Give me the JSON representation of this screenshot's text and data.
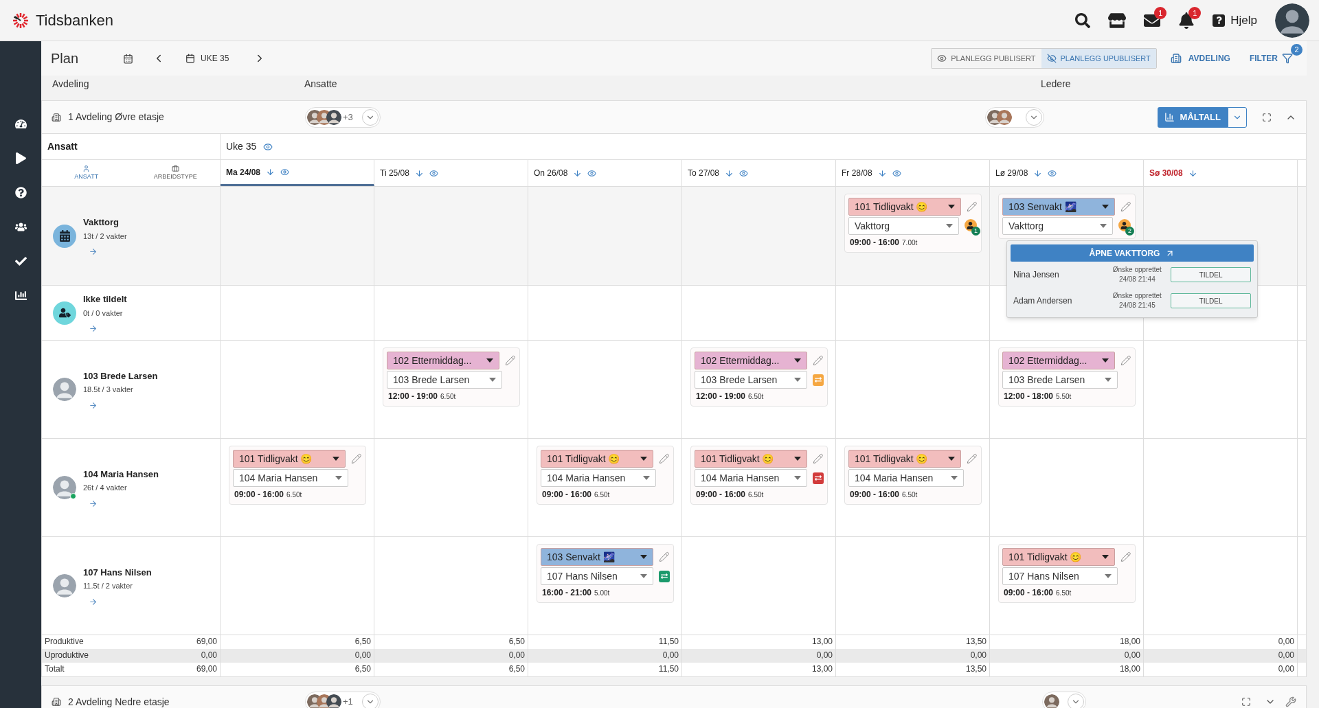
{
  "topbar": {
    "logo": "Tidsbanken",
    "mail_badge": "1",
    "bell_badge": "1",
    "help": "Hjelp"
  },
  "sidebar": {
    "items": [
      {
        "kind": "dashboard"
      },
      {
        "kind": "play"
      },
      {
        "kind": "help"
      },
      {
        "kind": "users"
      },
      {
        "kind": "check"
      },
      {
        "kind": "chart"
      }
    ]
  },
  "plan_bar": {
    "title": "Plan",
    "week": "UKE 35",
    "modes": [
      {
        "label": "PLANLEGG PUBLISERT",
        "selected": false,
        "kind": "published"
      },
      {
        "label": "PLANLEGG UPUBLISERT",
        "selected": true,
        "kind": "unpublished"
      }
    ],
    "department_button": "AVDELING",
    "filter_button": "FILTER",
    "filter_badge": "2"
  },
  "section_labels": [
    "Avdeling",
    "Ansatte",
    "Ledere"
  ],
  "department": {
    "name": "1 Avdeling Øvre etasje",
    "employees_more": "+3",
    "kpi_button": "MÅLTALL"
  },
  "grid": {
    "first_column": "Ansatt",
    "week": "Uke 35",
    "sort_options": [
      {
        "label": "ANSATT",
        "selected": true,
        "kind": "person"
      },
      {
        "label": "ARBEIDSTYPE",
        "selected": false,
        "kind": "work"
      }
    ],
    "days": [
      {
        "label": "Ma 24/08",
        "selected": true,
        "kind": "weekday",
        "eye": true
      },
      {
        "label": "Ti 25/08",
        "selected": false,
        "kind": "weekday",
        "eye": true
      },
      {
        "label": "On 26/08",
        "selected": false,
        "kind": "weekday",
        "eye": true
      },
      {
        "label": "To 27/08",
        "selected": false,
        "kind": "weekday",
        "eye": true
      },
      {
        "label": "Fr 28/08",
        "selected": false,
        "kind": "weekday",
        "eye": true
      },
      {
        "label": "Lø 29/08",
        "selected": false,
        "kind": "weekday",
        "eye": true
      },
      {
        "label": "Sø 30/08",
        "selected": false,
        "kind": "sunday",
        "eye": false
      }
    ],
    "rows": [
      {
        "kind": "vakttorg",
        "name": "Vakttorg",
        "summary": "13t / 2 vakter",
        "cells": [
          {
            "kind": "empty"
          },
          {
            "kind": "empty"
          },
          {
            "kind": "empty"
          },
          {
            "kind": "empty"
          },
          {
            "kind": "shift",
            "type": "101 Tidligvakt 😊",
            "color": "#f2bdbd",
            "assignee": "Vakttorg",
            "time": "09:00 - 16:00",
            "hours": "7.00t",
            "badge": {
              "kind": "requests",
              "count": "1"
            }
          },
          {
            "kind": "shift",
            "type": "103 Senvakt 🌌",
            "color": "#8fb4dc",
            "assignee": "Vakttorg",
            "badge": {
              "kind": "requests",
              "count": "2"
            },
            "popover": {
              "button": "ÅPNE VAKTTORG",
              "requests": [
                {
                  "name": "Nina Jensen",
                  "label": "Ønske opprettet",
                  "time": "24/08 21:44",
                  "action": "TILDEL"
                },
                {
                  "name": "Adam Andersen",
                  "label": "Ønske opprettet",
                  "time": "24/08 21:45",
                  "action": "TILDEL"
                }
              ]
            }
          },
          {
            "kind": "empty"
          }
        ]
      },
      {
        "kind": "unassigned",
        "name": "Ikke tildelt",
        "summary": "0t / 0 vakter",
        "cells": [
          {
            "kind": "empty"
          },
          {
            "kind": "empty"
          },
          {
            "kind": "empty"
          },
          {
            "kind": "empty"
          },
          {
            "kind": "empty"
          },
          {
            "kind": "empty"
          },
          {
            "kind": "empty"
          }
        ]
      },
      {
        "kind": "employee",
        "name": "103 Brede Larsen",
        "summary": "18.5t / 3 vakter",
        "online": false,
        "cells": [
          {
            "kind": "empty"
          },
          {
            "kind": "shift",
            "type": "102 Ettermiddag...",
            "color": "#e6b3d2",
            "assignee": "103 Brede Larsen",
            "time": "12:00 - 19:00",
            "hours": "6.50t"
          },
          {
            "kind": "empty"
          },
          {
            "kind": "shift",
            "type": "102 Ettermiddag...",
            "color": "#e6b3d2",
            "assignee": "103 Brede Larsen",
            "time": "12:00 - 19:00",
            "hours": "6.50t",
            "badge": {
              "kind": "swap",
              "color": "#f5a742"
            }
          },
          {
            "kind": "empty"
          },
          {
            "kind": "shift",
            "type": "102 Ettermiddag...",
            "color": "#e6b3d2",
            "assignee": "103 Brede Larsen",
            "time": "12:00 - 18:00",
            "hours": "5.50t"
          },
          {
            "kind": "empty"
          }
        ]
      },
      {
        "kind": "employee",
        "name": "104 Maria Hansen",
        "summary": "26t / 4 vakter",
        "online": true,
        "cells": [
          {
            "kind": "shift",
            "type": "101 Tidligvakt 😊",
            "color": "#f2bdbd",
            "assignee": "104 Maria Hansen",
            "time": "09:00 - 16:00",
            "hours": "6.50t"
          },
          {
            "kind": "empty"
          },
          {
            "kind": "shift",
            "type": "101 Tidligvakt 😊",
            "color": "#f2bdbd",
            "assignee": "104 Maria Hansen",
            "time": "09:00 - 16:00",
            "hours": "6.50t"
          },
          {
            "kind": "shift",
            "type": "101 Tidligvakt 😊",
            "color": "#f2bdbd",
            "assignee": "104 Maria Hansen",
            "time": "09:00 - 16:00",
            "hours": "6.50t",
            "badge": {
              "kind": "swap",
              "color": "#d23b3b"
            }
          },
          {
            "kind": "shift",
            "type": "101 Tidligvakt 😊",
            "color": "#f2bdbd",
            "assignee": "104 Maria Hansen",
            "time": "09:00 - 16:00",
            "hours": "6.50t"
          },
          {
            "kind": "empty"
          },
          {
            "kind": "empty"
          }
        ]
      },
      {
        "kind": "employee",
        "name": "107 Hans Nilsen",
        "summary": "11.5t / 2 vakter",
        "online": false,
        "cells": [
          {
            "kind": "empty"
          },
          {
            "kind": "empty"
          },
          {
            "kind": "shift",
            "type": "103 Senvakt 🌌",
            "color": "#8fb4dc",
            "assignee": "107 Hans Nilsen",
            "time": "16:00 - 21:00",
            "hours": "5.00t",
            "badge": {
              "kind": "swap",
              "color": "#1c9a6c"
            }
          },
          {
            "kind": "empty"
          },
          {
            "kind": "empty"
          },
          {
            "kind": "shift",
            "type": "101 Tidligvakt 😊",
            "color": "#f2bdbd",
            "assignee": "107 Hans Nilsen",
            "time": "09:00 - 16:00",
            "hours": "6.50t"
          },
          {
            "kind": "empty"
          }
        ]
      }
    ],
    "totals": [
      {
        "label": "Produktive",
        "total": "69,00",
        "values": [
          "6,50",
          "6,50",
          "11,50",
          "13,00",
          "13,50",
          "18,00",
          "0,00"
        ],
        "shaded": false
      },
      {
        "label": "Uproduktive",
        "total": "0,00",
        "values": [
          "0,00",
          "0,00",
          "0,00",
          "0,00",
          "0,00",
          "0,00",
          "0,00"
        ],
        "shaded": true
      },
      {
        "label": "Totalt",
        "total": "69,00",
        "values": [
          "6,50",
          "6,50",
          "11,50",
          "13,00",
          "13,50",
          "18,00",
          "0,00"
        ],
        "shaded": false
      }
    ]
  },
  "next_department": {
    "name": "2 Avdeling Nedre etasje",
    "employees_more": "+1"
  }
}
